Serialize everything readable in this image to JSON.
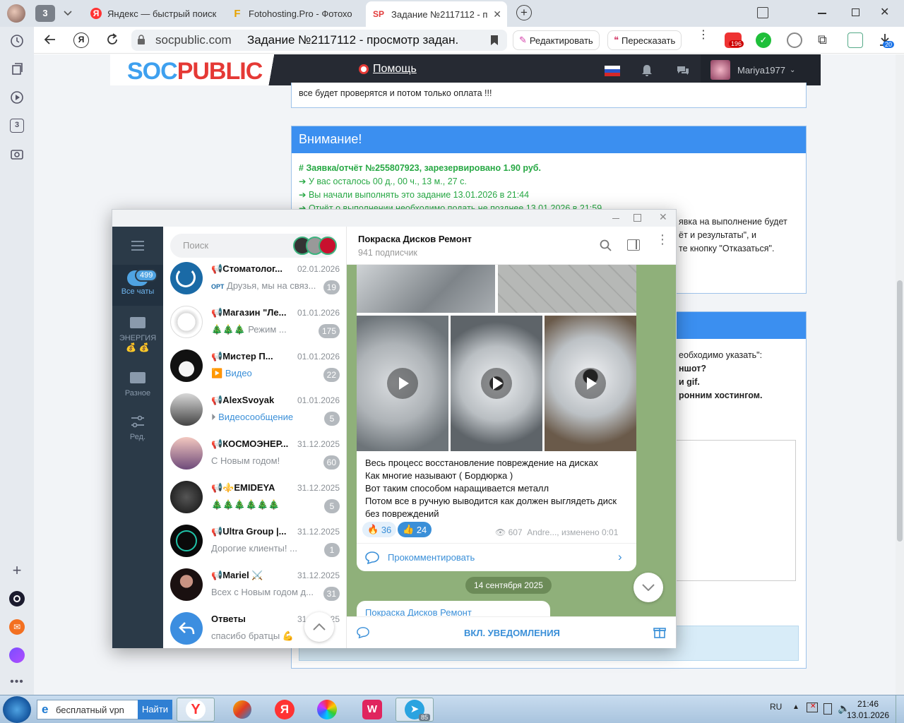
{
  "browser": {
    "tab_count": "3",
    "tabs": [
      {
        "title": "Яндекс — быстрый поиск",
        "favicon": "Я"
      },
      {
        "title": "Fotohosting.Pro - Фотохо",
        "favicon": "F"
      },
      {
        "title": "Задание №2117112 - п",
        "favicon": "SP"
      }
    ],
    "address": {
      "domain": "socpublic.com",
      "page_title": "Задание №2117112 - просмотр задан..."
    },
    "edit_label": "Редактировать",
    "retell_label": "Пересказать",
    "mail_badge": "196",
    "download_badge": "20",
    "side_tab_count": "3"
  },
  "site": {
    "logo_soc": "SOC",
    "logo_public": "PUBLIC",
    "help_label": "Помощь",
    "username": "Mariya1977",
    "top_note": "все будет проверятся и потом только оплата !!!",
    "attention": {
      "title": "Внимание!",
      "report": "Заявка/отчёт №255807923, зарезервировано 1.90 руб.",
      "lines": [
        "У вас осталось 00 д., 00 ч., 13 м., 27 с.",
        "Вы начали выполнять это задание 13.01.2026 в 21:44",
        "Отчёт о выполнении необходимо подать не позднее 13.01.2026 в 21:59"
      ],
      "right_lines": [
        "явка на выполнение будет",
        "ёт и результаты\", и",
        "те кнопку \"Отказаться\"."
      ]
    },
    "second_card_lines": [
      "еобходимо указать\":",
      "ншот?",
      "и gif.",
      "ронним хостингом."
    ]
  },
  "telegram": {
    "search_placeholder": "Поиск",
    "nav": [
      {
        "label": "Все чаты",
        "badge": "499"
      },
      {
        "label": "ЭНЕРГИЯ"
      },
      {
        "label": "Разное"
      },
      {
        "label": "Ред."
      }
    ],
    "chats": [
      {
        "name": "Стоматолог...",
        "date": "02.01.2026",
        "preview_prefix": "ОРТ",
        "preview": "Друзья, мы на связ...",
        "count": "19"
      },
      {
        "name": "Магазин \"Ле...",
        "date": "01.01.2026",
        "preview_prefix": "🎄🎄🎄",
        "preview": "Режим ...",
        "count": "175"
      },
      {
        "name": "Мистер П...",
        "date": "01.01.2026",
        "preview": "Видео",
        "count": "22"
      },
      {
        "name": "AlexSvoyak",
        "date": "01.01.2026",
        "preview": "Видеосообщение",
        "count": "5"
      },
      {
        "name": "КОСМОЭНЕР...",
        "date": "31.12.2025",
        "preview": "С Новым годом!",
        "count": "60"
      },
      {
        "name": "⚜️EMIDEYA",
        "date": "31.12.2025",
        "preview": "🎄🎄🎄🎄🎄🎄",
        "count": "5"
      },
      {
        "name": "Ultra Group |...",
        "date": "31.12.2025",
        "preview": "Дорогие клиенты! ...",
        "count": "1"
      },
      {
        "name": "Mariel ⚔️",
        "date": "31.12.2025",
        "preview": "Всех с Новым годом д...",
        "count": "31"
      },
      {
        "name": "Ответы",
        "date": "31.12.2025",
        "preview": "спасибо братцы 💪",
        "count": ""
      }
    ],
    "channel": {
      "name": "Покраска Дисков Ремонт",
      "subscribers": "941 подписчик",
      "post_lines": [
        "Весь процесс восстановление повреждение на дисках",
        "Как многие называют ( Бордюрка )",
        "Вот таким способом наращивается металл",
        "Потом все в ручную выводится как должен выглядеть диск",
        "без повреждений"
      ],
      "reactions": [
        {
          "emoji": "🔥",
          "count": "36"
        },
        {
          "emoji": "👍",
          "count": "24"
        }
      ],
      "views": "607",
      "author": "Andre..., изменено 0:01",
      "comment_label": "Прокомментировать",
      "date_divider": "14 сентября 2025",
      "next_post_title": "Покраска Дисков Ремонт",
      "notify_label": "ВКЛ. УВЕДОМЛЕНИЯ"
    }
  },
  "taskbar": {
    "search_value": "бесплатный vpn",
    "search_button": "Найти",
    "lang": "RU",
    "time": "21:46",
    "date": "13.01.2026",
    "telegram_badge": "85"
  },
  "colors": {
    "accent_blue": "#3b8ff0",
    "success_green": "#27a844",
    "tg_nav": "#2b3a48",
    "tg_badge": "#4fa3e2"
  }
}
